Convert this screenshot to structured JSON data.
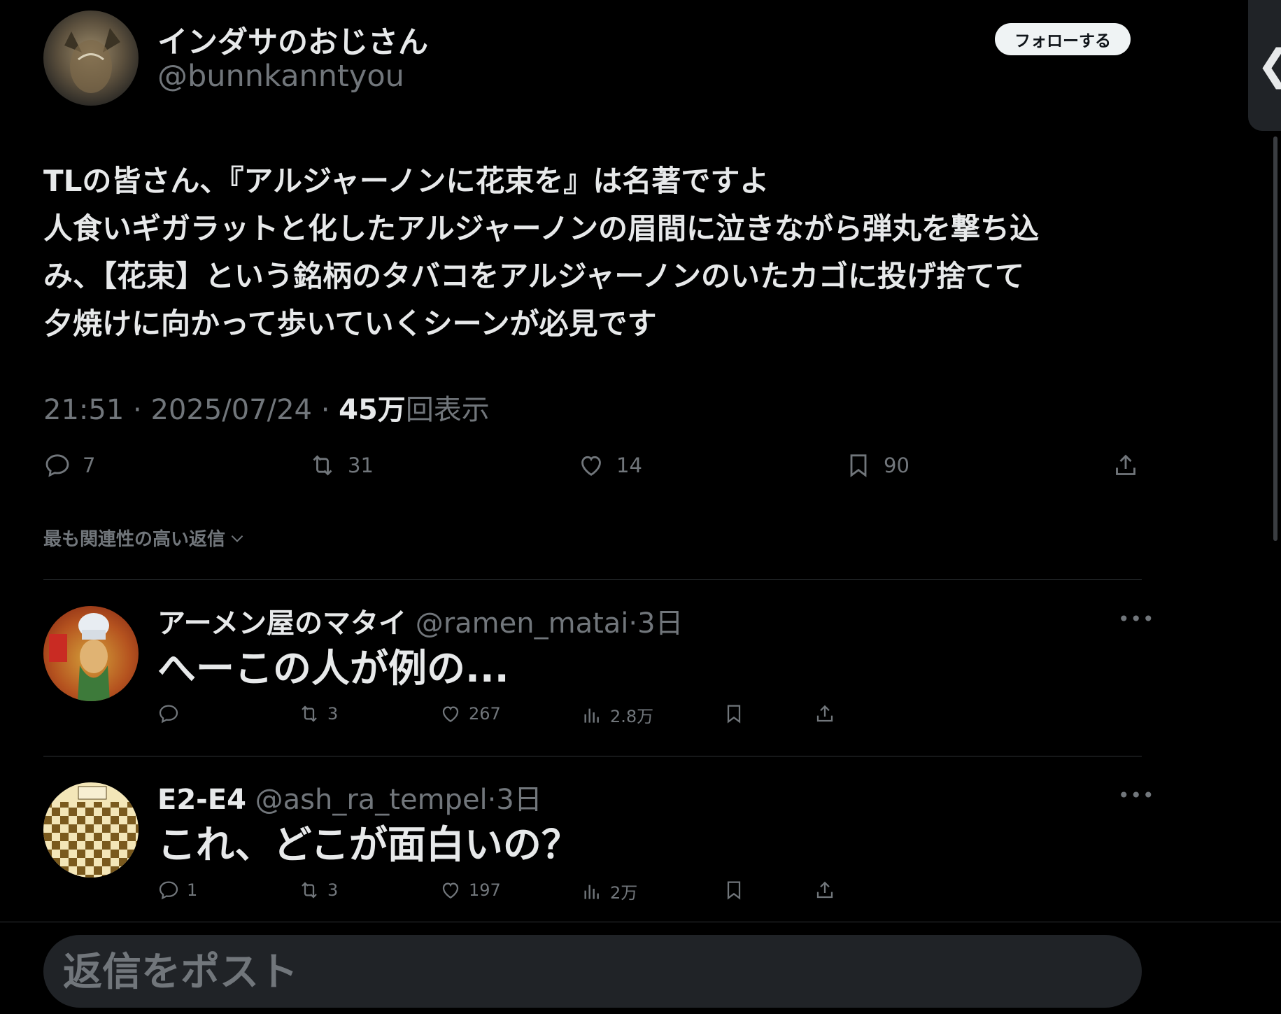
{
  "tweet": {
    "author_name": "インダサのおじさん",
    "author_handle": "@bunnkanntyou",
    "follow_label": "フォローする",
    "lines": [
      "TLの皆さん、『アルジャーノンに花束を』は名著ですよ",
      "人食いギガラットと化したアルジャーノンの眉間に泣きながら弾丸を撃ち込",
      "み、【花束】という銘柄のタバコをアルジャーノンのいたカゴに投げ捨てて",
      "夕焼けに向かって歩いていくシーンが必見です"
    ],
    "time": "21:51",
    "date": "2025/07/24",
    "views_count": "45万",
    "views_label": "回表示",
    "actions": {
      "replies": "7",
      "reposts": "31",
      "likes": "14",
      "bookmarks": "90"
    }
  },
  "sort_label": "最も関連性の高い返信",
  "replies": [
    {
      "name": "アーメン屋のマタイ",
      "handle": "@ramen_matai",
      "age": "3日",
      "text": "へーこの人が例の...",
      "replies": "",
      "reposts": "3",
      "likes": "267",
      "views": "2.8万"
    },
    {
      "name": "E2-E4",
      "handle": "@ash_ra_tempel",
      "age": "3日",
      "text": "これ、どこが面白いの？",
      "replies": "1",
      "reposts": "3",
      "likes": "197",
      "views": "2万"
    }
  ],
  "composer": {
    "placeholder": "返信をポスト"
  },
  "colors": {
    "background": "#000000",
    "text": "#e7e9ea",
    "secondary": "#71767b",
    "divider": "#2f3336"
  }
}
